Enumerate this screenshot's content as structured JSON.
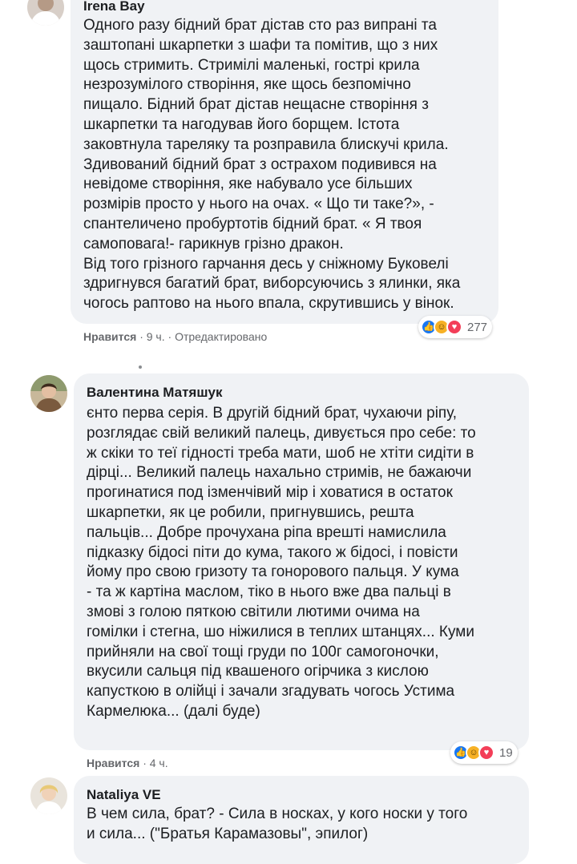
{
  "comments": [
    {
      "author": "Irena Bay",
      "lines": [
        "Одного разу бідний брат дістав сто раз випрані та",
        "заштопані шкарпетки з шафи та помітив, що з них",
        "щось стримить. Стримілі маленькі, гострі крила",
        "незрозумілого створіння, яке щось безпомічно",
        "пищало. Бідний брат дістав нещасне створіння з",
        "шкарпетки та нагодував його борщем. Істота",
        "заковтнула тареляку та розправила блискучі крила.",
        "Здивований бідний брат з острахом подивився на",
        "невідоме створіння, яке набувало усе більших",
        "розмірів просто у нього на очах. « Що ти таке?», -",
        "спантеличено пробуртотів бідний брат. « Я твоя",
        "самоповага!- гарикнув грізно дракон.",
        "Від того грізного гарчання десь у сніжному Буковелі",
        "здригнувся багатий брат, виборсуючись з ялинки, яка",
        "чогось раптово на нього впала, скрутившись у вінок."
      ],
      "like_label": "Нравится",
      "time": "9 ч.",
      "edited": "Отредактировано",
      "reaction_count": "277"
    },
    {
      "author": "Валентина Матяшук",
      "lines": [
        "єнто перва серія. В другій бідний брат, чухаючи ріпу,",
        "розглядає свій великий палець, дивується про себе: то",
        "ж скіки то теї гідності треба мати, шоб не хтіти сидіти в",
        "дірці... Великий палець нахально стримів, не бажаючи",
        "прогинатися под ізменчівий мір і ховатися в остаток",
        "шкарпетки, як це робили, пригнувшись, решта",
        "пальців... Добре прочухана ріпа врешті намислила",
        "підказку бідосі піти до кума, такого ж бідосі, і повісти",
        "йому про свою гризоту та гонорового пальця. У кума",
        "- та ж картіна маслом, тіко в нього вже два пальці в",
        "змові з голою пяткою світили лютими очима на",
        "гомілки і стегна, шо ніжилися в теплих штанцях... Куми",
        "прийняли на свої тощі груди по 100г самогоночки,",
        "вкусили сальця під квашеного огірчика з кислою",
        "капусткою в олійці і зачали згадувать чогось Устима",
        "Кармелюка... (далі буде)"
      ],
      "like_label": "Нравится",
      "time": "4 ч.",
      "reaction_count": "19"
    },
    {
      "author": "Nataliya VE",
      "lines": [
        "В чем сила, брат? - Сила в носках, у кого носки у того",
        "и сила... (\"Братья Карамазовы\", эпилог)"
      ]
    }
  ],
  "reaction_icons": [
    "like-icon",
    "haha-icon",
    "love-icon"
  ],
  "colors": {
    "bubble": "#f0f2f5",
    "meta": "#65676b",
    "like": "#1877f2",
    "haha": "#f7b125",
    "love": "#f33e58"
  }
}
